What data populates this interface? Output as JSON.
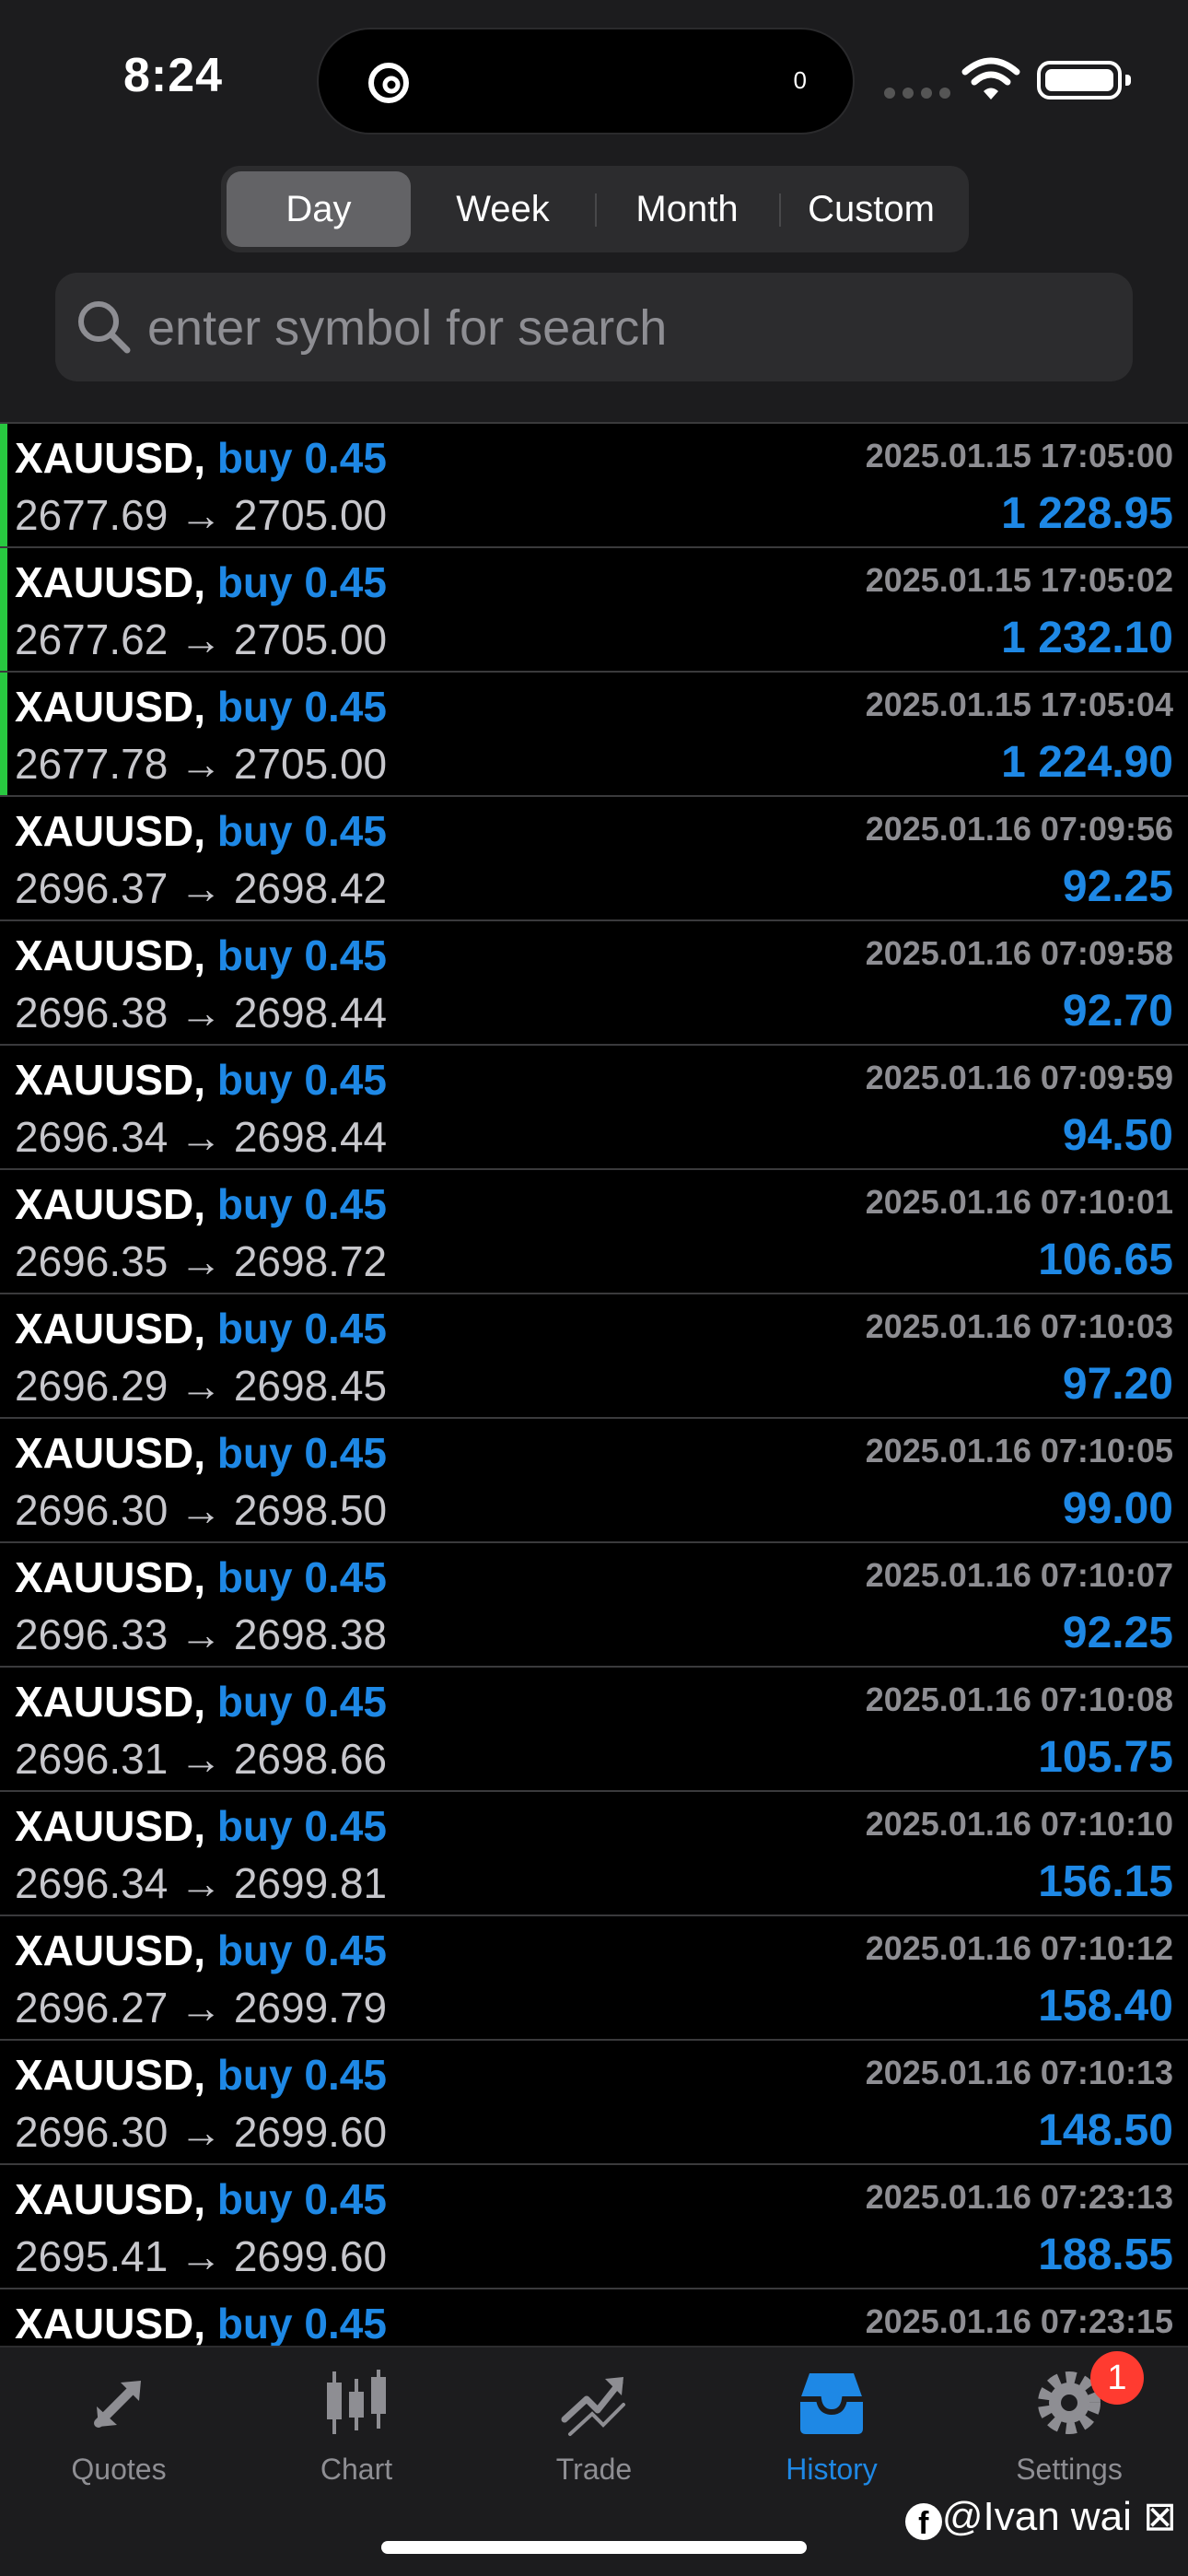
{
  "status_bar": {
    "time": "8:24",
    "island_count": "0"
  },
  "tabs_period": [
    "Day",
    "Week",
    "Month",
    "Custom"
  ],
  "active_period": "Day",
  "search": {
    "placeholder": "enter symbol for search"
  },
  "colors": {
    "accent": "#1e88e5",
    "closed_marker": "#28c840",
    "badge": "#ff3b30"
  },
  "trades": [
    {
      "symbol": "XAUUSD,",
      "side": "buy 0.45",
      "open": "2677.69",
      "arrow": "→",
      "close": "2705.00",
      "date": "2025.01.15 17:05:00",
      "profit": "1 228.95",
      "marked": true
    },
    {
      "symbol": "XAUUSD,",
      "side": "buy 0.45",
      "open": "2677.62",
      "arrow": "→",
      "close": "2705.00",
      "date": "2025.01.15 17:05:02",
      "profit": "1 232.10",
      "marked": true
    },
    {
      "symbol": "XAUUSD,",
      "side": "buy 0.45",
      "open": "2677.78",
      "arrow": "→",
      "close": "2705.00",
      "date": "2025.01.15 17:05:04",
      "profit": "1 224.90",
      "marked": true
    },
    {
      "symbol": "XAUUSD,",
      "side": "buy 0.45",
      "open": "2696.37",
      "arrow": "→",
      "close": "2698.42",
      "date": "2025.01.16 07:09:56",
      "profit": "92.25",
      "marked": false
    },
    {
      "symbol": "XAUUSD,",
      "side": "buy 0.45",
      "open": "2696.38",
      "arrow": "→",
      "close": "2698.44",
      "date": "2025.01.16 07:09:58",
      "profit": "92.70",
      "marked": false
    },
    {
      "symbol": "XAUUSD,",
      "side": "buy 0.45",
      "open": "2696.34",
      "arrow": "→",
      "close": "2698.44",
      "date": "2025.01.16 07:09:59",
      "profit": "94.50",
      "marked": false
    },
    {
      "symbol": "XAUUSD,",
      "side": "buy 0.45",
      "open": "2696.35",
      "arrow": "→",
      "close": "2698.72",
      "date": "2025.01.16 07:10:01",
      "profit": "106.65",
      "marked": false
    },
    {
      "symbol": "XAUUSD,",
      "side": "buy 0.45",
      "open": "2696.29",
      "arrow": "→",
      "close": "2698.45",
      "date": "2025.01.16 07:10:03",
      "profit": "97.20",
      "marked": false
    },
    {
      "symbol": "XAUUSD,",
      "side": "buy 0.45",
      "open": "2696.30",
      "arrow": "→",
      "close": "2698.50",
      "date": "2025.01.16 07:10:05",
      "profit": "99.00",
      "marked": false
    },
    {
      "symbol": "XAUUSD,",
      "side": "buy 0.45",
      "open": "2696.33",
      "arrow": "→",
      "close": "2698.38",
      "date": "2025.01.16 07:10:07",
      "profit": "92.25",
      "marked": false
    },
    {
      "symbol": "XAUUSD,",
      "side": "buy 0.45",
      "open": "2696.31",
      "arrow": "→",
      "close": "2698.66",
      "date": "2025.01.16 07:10:08",
      "profit": "105.75",
      "marked": false
    },
    {
      "symbol": "XAUUSD,",
      "side": "buy 0.45",
      "open": "2696.34",
      "arrow": "→",
      "close": "2699.81",
      "date": "2025.01.16 07:10:10",
      "profit": "156.15",
      "marked": false
    },
    {
      "symbol": "XAUUSD,",
      "side": "buy 0.45",
      "open": "2696.27",
      "arrow": "→",
      "close": "2699.79",
      "date": "2025.01.16 07:10:12",
      "profit": "158.40",
      "marked": false
    },
    {
      "symbol": "XAUUSD,",
      "side": "buy 0.45",
      "open": "2696.30",
      "arrow": "→",
      "close": "2699.60",
      "date": "2025.01.16 07:10:13",
      "profit": "148.50",
      "marked": false
    },
    {
      "symbol": "XAUUSD,",
      "side": "buy 0.45",
      "open": "2695.41",
      "arrow": "→",
      "close": "2699.60",
      "date": "2025.01.16 07:23:13",
      "profit": "188.55",
      "marked": false
    },
    {
      "symbol": "XAUUSD,",
      "side": "buy 0.45",
      "open": "",
      "arrow": "",
      "close": "",
      "date": "2025.01.16 07:23:15",
      "profit": "",
      "marked": false
    }
  ],
  "tabbar": {
    "quotes": "Quotes",
    "chart": "Chart",
    "trade": "Trade",
    "history": "History",
    "settings": "Settings",
    "settings_badge": "1"
  },
  "watermark": {
    "fb_glyph": "f",
    "text": "@Ivan wai ⊠"
  }
}
